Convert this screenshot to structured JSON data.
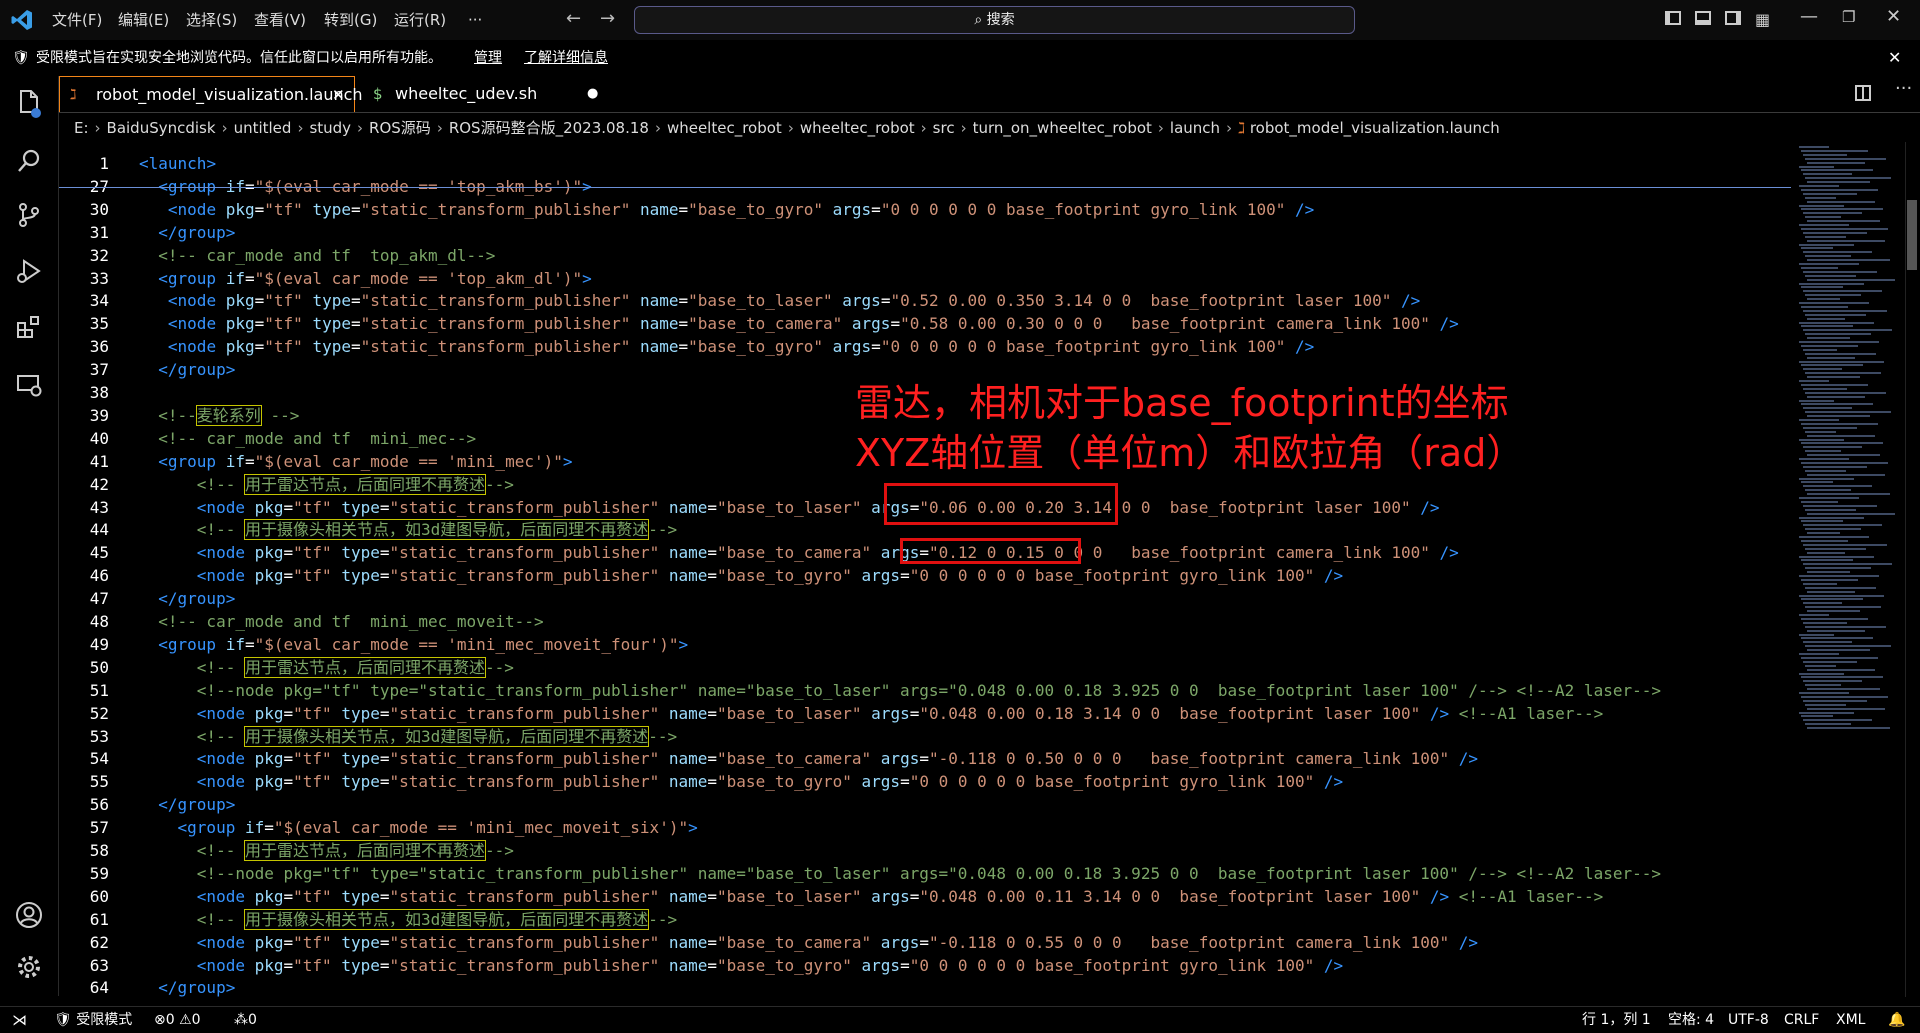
{
  "titlebar": {
    "menu": [
      "文件(F)",
      "编辑(E)",
      "选择(S)",
      "查看(V)",
      "转到(G)",
      "运行(R)",
      "···"
    ],
    "search_placeholder": "搜索"
  },
  "banner": {
    "message": "受限模式旨在实现安全地浏览代码。信任此窗口以启用所有功能。",
    "manage": "管理",
    "learn_more": "了解详细信息"
  },
  "tabs": [
    {
      "label": "robot_model_visualization.launch",
      "active": true
    },
    {
      "label": "wheeltec_udev.sh",
      "active": false,
      "dirty": true
    }
  ],
  "breadcrumbs": [
    "E:",
    "BaiduSyncdisk",
    "untitled",
    "study",
    "ROS源码",
    "ROS源码整合版_2023.08.18",
    "wheeltec_robot",
    "wheeltec_robot",
    "src",
    "turn_on_wheeltec_robot",
    "launch",
    "robot_model_visualization.launch"
  ],
  "annotation": {
    "line1": "雷达，相机对于base_footprint的坐标",
    "line2": "XYZ轴位置（单位m）和欧拉角（rad）"
  },
  "status": {
    "restricted": "受限模式",
    "errors": "0",
    "warnings": "0",
    "ports": "0",
    "position": "行 1，列 1",
    "spaces": "空格: 4",
    "encoding": "UTF-8",
    "eol": "CRLF",
    "language": "XML"
  },
  "lines": [
    {
      "n": "1",
      "code": "<launch>"
    },
    {
      "n": "27",
      "code": "  <group if=\"$(eval car_mode == 'top_akm_bs')\">"
    },
    {
      "n": "30",
      "code": "   <node pkg=\"tf\" type=\"static_transform_publisher\" name=\"base_to_gyro\" args=\"0 0 0 0 0 0 base_footprint gyro_link 100\" />"
    },
    {
      "n": "31",
      "code": "  </group>"
    },
    {
      "n": "32",
      "code": "  <!-- car_mode and tf  top_akm_dl-->"
    },
    {
      "n": "33",
      "code": "  <group if=\"$(eval car_mode == 'top_akm_dl')\">"
    },
    {
      "n": "34",
      "code": "   <node pkg=\"tf\" type=\"static_transform_publisher\" name=\"base_to_laser\" args=\"0.52 0.00 0.350 3.14 0 0  base_footprint laser 100\" />"
    },
    {
      "n": "35",
      "code": "   <node pkg=\"tf\" type=\"static_transform_publisher\" name=\"base_to_camera\" args=\"0.58 0.00 0.30 0 0 0   base_footprint camera_link 100\" />"
    },
    {
      "n": "36",
      "code": "   <node pkg=\"tf\" type=\"static_transform_publisher\" name=\"base_to_gyro\" args=\"0 0 0 0 0 0 base_footprint gyro_link 100\" />"
    },
    {
      "n": "37",
      "code": "  </group>"
    },
    {
      "n": "38",
      "code": ""
    },
    {
      "n": "39",
      "code": "  <!--麦轮系列 -->"
    },
    {
      "n": "40",
      "code": "  <!-- car_mode and tf  mini_mec-->"
    },
    {
      "n": "41",
      "code": "  <group if=\"$(eval car_mode == 'mini_mec')\">"
    },
    {
      "n": "42",
      "code": "      <!-- 用于雷达节点，后面同理不再赘述-->"
    },
    {
      "n": "43",
      "code": "      <node pkg=\"tf\" type=\"static_transform_publisher\" name=\"base_to_laser\" args=\"0.06 0.00 0.20 3.14 0 0  base_footprint laser 100\" />"
    },
    {
      "n": "44",
      "code": "      <!-- 用于摄像头相关节点，如3d建图导航，后面同理不再赘述-->"
    },
    {
      "n": "45",
      "code": "      <node pkg=\"tf\" type=\"static_transform_publisher\" name=\"base_to_camera\" args=\"0.12 0 0.15 0 0 0   base_footprint camera_link 100\" />"
    },
    {
      "n": "46",
      "code": "      <node pkg=\"tf\" type=\"static_transform_publisher\" name=\"base_to_gyro\" args=\"0 0 0 0 0 0 base_footprint gyro_link 100\" />"
    },
    {
      "n": "47",
      "code": "  </group>"
    },
    {
      "n": "48",
      "code": "  <!-- car_mode and tf  mini_mec_moveit-->"
    },
    {
      "n": "49",
      "code": "  <group if=\"$(eval car_mode == 'mini_mec_moveit_four')\">"
    },
    {
      "n": "50",
      "code": "      <!-- 用于雷达节点，后面同理不再赘述-->"
    },
    {
      "n": "51",
      "code": "      <!--node pkg=\"tf\" type=\"static_transform_publisher\" name=\"base_to_laser\" args=\"0.048 0.00 0.18 3.925 0 0  base_footprint laser 100\" /--> <!--A2 laser-->"
    },
    {
      "n": "52",
      "code": "      <node pkg=\"tf\" type=\"static_transform_publisher\" name=\"base_to_laser\" args=\"0.048 0.00 0.18 3.14 0 0  base_footprint laser 100\" /> <!--A1 laser-->"
    },
    {
      "n": "53",
      "code": "      <!-- 用于摄像头相关节点，如3d建图导航，后面同理不再赘述-->"
    },
    {
      "n": "54",
      "code": "      <node pkg=\"tf\" type=\"static_transform_publisher\" name=\"base_to_camera\" args=\"-0.118 0 0.50 0 0 0   base_footprint camera_link 100\" />"
    },
    {
      "n": "55",
      "code": "      <node pkg=\"tf\" type=\"static_transform_publisher\" name=\"base_to_gyro\" args=\"0 0 0 0 0 0 base_footprint gyro_link 100\" />"
    },
    {
      "n": "56",
      "code": "  </group>"
    },
    {
      "n": "57",
      "code": "    <group if=\"$(eval car_mode == 'mini_mec_moveit_six')\">"
    },
    {
      "n": "58",
      "code": "      <!-- 用于雷达节点，后面同理不再赘述-->"
    },
    {
      "n": "59",
      "code": "      <!--node pkg=\"tf\" type=\"static_transform_publisher\" name=\"base_to_laser\" args=\"0.048 0.00 0.18 3.925 0 0  base_footprint laser 100\" /--> <!--A2 laser-->"
    },
    {
      "n": "60",
      "code": "      <node pkg=\"tf\" type=\"static_transform_publisher\" name=\"base_to_laser\" args=\"0.048 0.00 0.11 3.14 0 0  base_footprint laser 100\" /> <!--A1 laser-->"
    },
    {
      "n": "61",
      "code": "      <!-- 用于摄像头相关节点，如3d建图导航，后面同理不再赘述-->"
    },
    {
      "n": "62",
      "code": "      <node pkg=\"tf\" type=\"static_transform_publisher\" name=\"base_to_camera\" args=\"-0.118 0 0.55 0 0 0   base_footprint camera_link 100\" />"
    },
    {
      "n": "63",
      "code": "      <node pkg=\"tf\" type=\"static_transform_publisher\" name=\"base_to_gyro\" args=\"0 0 0 0 0 0 base_footprint gyro_link 100\" />"
    },
    {
      "n": "64",
      "code": "  </group>"
    }
  ]
}
